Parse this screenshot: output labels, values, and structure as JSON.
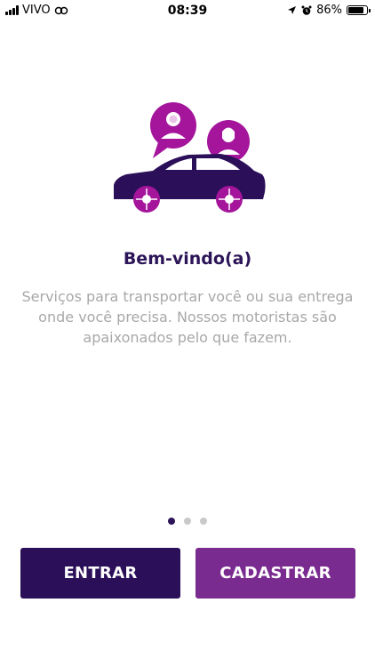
{
  "status": {
    "carrier": "VIVO",
    "time": "08:39",
    "battery": "86%",
    "battery_level": 0.86
  },
  "onboarding": {
    "title": "Bem-vindo(a)",
    "description": "Serviços para transportar você ou sua entrega onde você precisa. Nossos motoristas são apaixonados pelo que fazem.",
    "page_index": 0,
    "page_count": 3
  },
  "actions": {
    "login_label": "ENTRAR",
    "signup_label": "CADASTRAR"
  },
  "colors": {
    "primary": "#2b1059",
    "secondary": "#7a2b8f",
    "accent_magenta": "#a4159b",
    "text_muted": "#a8a8a8"
  }
}
